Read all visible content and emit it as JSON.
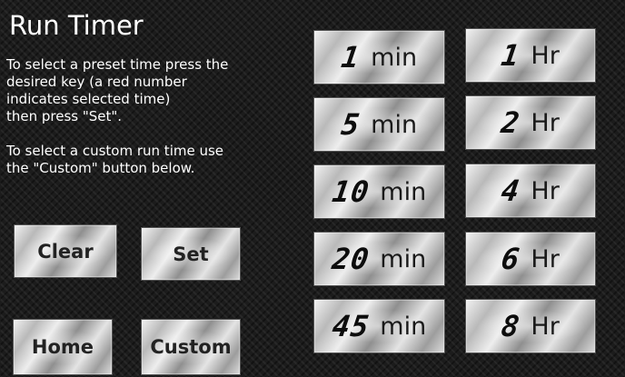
{
  "title": "Run Timer",
  "instructions": {
    "line1": "To select a preset time press the\ndesired key (a red number\nindicates selected time)\nthen press \"Set\".",
    "line2": "To select a custom run time use\nthe \"Custom\" button below."
  },
  "buttons": {
    "clear": "Clear",
    "set": "Set",
    "home": "Home",
    "custom": "Custom"
  },
  "minutes": [
    {
      "value": "1",
      "unit": "min"
    },
    {
      "value": "5",
      "unit": "min"
    },
    {
      "value": "10",
      "unit": "min"
    },
    {
      "value": "20",
      "unit": "min"
    },
    {
      "value": "45",
      "unit": "min"
    }
  ],
  "hours": [
    {
      "value": "1",
      "unit": "Hr"
    },
    {
      "value": "2",
      "unit": "Hr"
    },
    {
      "value": "4",
      "unit": "Hr"
    },
    {
      "value": "6",
      "unit": "Hr"
    },
    {
      "value": "8",
      "unit": "Hr"
    }
  ]
}
